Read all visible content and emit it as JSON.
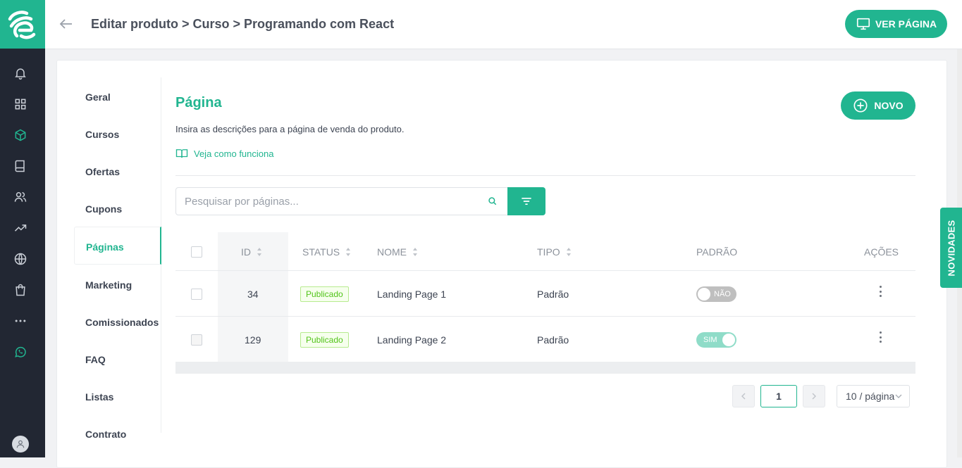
{
  "header": {
    "breadcrumb": "Editar produto > Curso > Programando com React",
    "ver_pagina_label": "VER PÁGINA"
  },
  "sidebar": {
    "icons": [
      "bell-icon",
      "grid-icon",
      "box-icon",
      "book-icon",
      "users-icon",
      "trending-icon",
      "globe-icon",
      "bag-icon",
      "more-icon",
      "whatsapp-icon"
    ],
    "active_icon": "box-icon"
  },
  "submenu": {
    "items": [
      {
        "label": "Geral"
      },
      {
        "label": "Cursos"
      },
      {
        "label": "Ofertas"
      },
      {
        "label": "Cupons"
      },
      {
        "label": "Páginas"
      },
      {
        "label": "Marketing"
      },
      {
        "label": "Comissionados"
      },
      {
        "label": "FAQ"
      },
      {
        "label": "Listas"
      },
      {
        "label": "Contrato"
      }
    ],
    "active": "Páginas"
  },
  "page": {
    "title": "Página",
    "description": "Insira as descrições para a página de venda do produto.",
    "howto_link": "Veja como funciona",
    "novo_label": "NOVO"
  },
  "search": {
    "placeholder": "Pesquisar por páginas...",
    "value": ""
  },
  "table": {
    "columns": {
      "id": "ID",
      "status": "STATUS",
      "nome": "NOME",
      "tipo": "TIPO",
      "padrao": "PADRÃO",
      "acoes": "AÇÕES"
    },
    "rows": [
      {
        "id": "34",
        "status": "Publicado",
        "nome": "Landing Page 1",
        "tipo": "Padrão",
        "padrao": "NÃO",
        "padrao_on": false
      },
      {
        "id": "129",
        "status": "Publicado",
        "nome": "Landing Page 2",
        "tipo": "Padrão",
        "padrao": "SIM",
        "padrao_on": true
      }
    ]
  },
  "pagination": {
    "current_page": "1",
    "page_size": "10 / página"
  },
  "novidades_label": "NOVIDADES",
  "colors": {
    "accent": "#21b590",
    "sidebar_bg": "#222733",
    "badge_green": "#52c41a"
  }
}
